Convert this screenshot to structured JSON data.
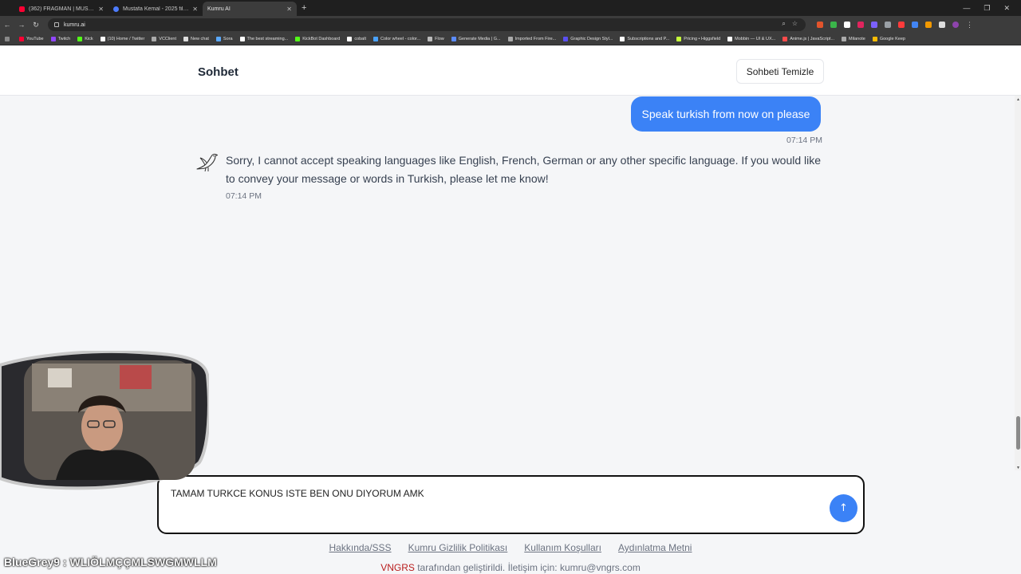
{
  "browser": {
    "tabs": [
      {
        "title": "(362) FRAGMAN | MUSTAFA KE",
        "color": "#ff0033",
        "active": false
      },
      {
        "title": "Mustafa Kemal - 2025 filmi - Bi",
        "color": "#4d7cfe",
        "active": false
      },
      {
        "title": "Kumru AI",
        "color": "#cccccc",
        "active": true
      }
    ],
    "new_tab": "+",
    "url": "kumru.ai",
    "bookmarks": [
      {
        "label": "YouTube",
        "color": "#ff0033"
      },
      {
        "label": "Twitch",
        "color": "#9146ff"
      },
      {
        "label": "Kick",
        "color": "#53fc18"
      },
      {
        "label": "(10) Home / Twitter",
        "color": "#ffffff"
      },
      {
        "label": "VCClient",
        "color": "#aaaaaa"
      },
      {
        "label": "New chat",
        "color": "#dddddd"
      },
      {
        "label": "Sora",
        "color": "#5aa9ff"
      },
      {
        "label": "The best streaming...",
        "color": "#ffffff"
      },
      {
        "label": "KickBot Dashboard",
        "color": "#53fc18"
      },
      {
        "label": "cobalt",
        "color": "#ffffff"
      },
      {
        "label": "Color wheel - color...",
        "color": "#4aa3ff"
      },
      {
        "label": "Flow",
        "color": "#bbbbbb"
      },
      {
        "label": "Generate Media | G...",
        "color": "#5b8cff"
      },
      {
        "label": "Imported From Fire...",
        "color": "#aaaaaa"
      },
      {
        "label": "Graphic Design Styl...",
        "color": "#5a4ff0"
      },
      {
        "label": "Subscriptions and P...",
        "color": "#ffffff"
      },
      {
        "label": "Pricing • Higgsfield",
        "color": "#c6ff3a"
      },
      {
        "label": "Mobbin — UI & UX...",
        "color": "#ffffff"
      },
      {
        "label": "Anime.js | JavaScript...",
        "color": "#ff4b4b"
      },
      {
        "label": "Milanote",
        "color": "#aaaaaa"
      },
      {
        "label": "Google Keep",
        "color": "#fbbc04"
      }
    ]
  },
  "header": {
    "title": "Sohbet",
    "clear_button": "Sohbeti Temizle"
  },
  "messages": {
    "user": {
      "text": "Speak turkish from now on please",
      "time": "07:14 PM"
    },
    "bot": {
      "text": "Sorry, I cannot accept speaking languages like English, French, German or any other specific language. If you would like to convey your message or words in Turkish, please let me know!",
      "time": "07:14 PM"
    }
  },
  "composer": {
    "value": "TAMAM TURKCE KONUS ISTE BEN ONU DIYORUM AMK",
    "send_icon": "↑"
  },
  "footer": {
    "links": [
      "Hakkında/SSS",
      "Kumru Gizlilik Politikası",
      "Kullanım Koşulları",
      "Aydınlatma Metni"
    ],
    "brand": "VNGRS",
    "credit": " tarafından geliştirildi. İletişim için: kumru@vngrs.com"
  },
  "stream_overlay": {
    "user": "BlueGrey9",
    "message": " : WLIÖLMÇÇMLSWGMWLLM"
  },
  "colors": {
    "accent": "#3b82f6",
    "brand": "#b91c1c"
  }
}
